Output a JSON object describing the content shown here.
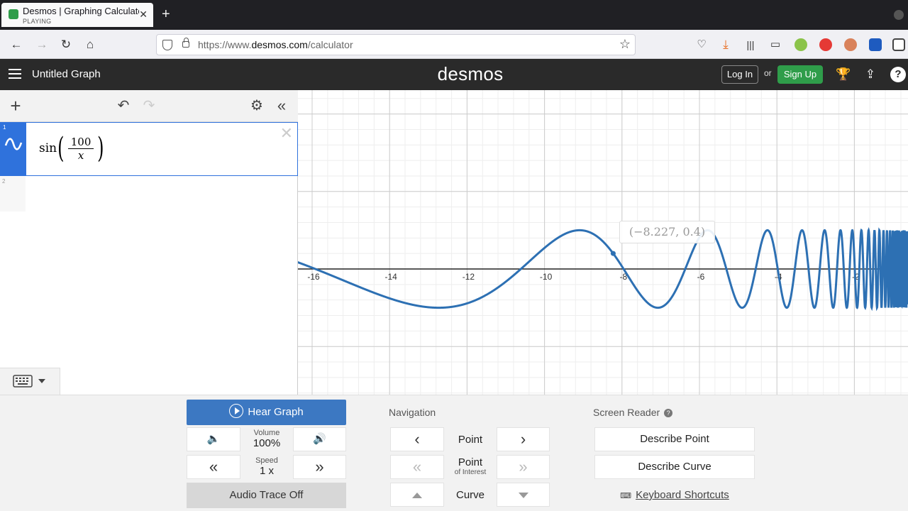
{
  "browser": {
    "tab_title": "Desmos | Graphing Calculator",
    "tab_subtitle": "PLAYING",
    "url_prefix": "https://www.",
    "url_domain": "desmos.com",
    "url_path": "/calculator"
  },
  "header": {
    "graph_title": "Untitled Graph",
    "logo": "desmos",
    "login_label": "Log In",
    "or_label": "or",
    "signup_label": "Sign Up"
  },
  "expressions": [
    {
      "index": "1",
      "func": "sin",
      "numerator": "100",
      "denominator": "x"
    },
    {
      "index": "2"
    }
  ],
  "graph": {
    "x_ticks": [
      "-16",
      "-14",
      "-12",
      "-10",
      "-8",
      "-6",
      "-4",
      "-2"
    ],
    "tooltip": "(−8.227, 0.4)",
    "curve_color": "#2d70b3",
    "trace_point": {
      "x": -8.227,
      "y": 0.4
    }
  },
  "audio_panel": {
    "hear_graph_label": "Hear Graph",
    "volume_label": "Volume",
    "volume_value": "100%",
    "speed_label": "Speed",
    "speed_value": "1 x",
    "audio_trace_label": "Audio Trace Off",
    "navigation_title": "Navigation",
    "nav_point": "Point",
    "nav_poi_line1": "Point",
    "nav_poi_line2": "of Interest",
    "nav_curve": "Curve",
    "screen_reader_title": "Screen Reader",
    "describe_point": "Describe Point",
    "describe_curve": "Describe Curve",
    "keyboard_shortcuts": "Keyboard Shortcuts"
  },
  "colors": {
    "accent": "#2f72dc",
    "hear_button": "#3c78c2",
    "signup": "#2f9d4a",
    "header_bg": "#2a2a2a"
  }
}
